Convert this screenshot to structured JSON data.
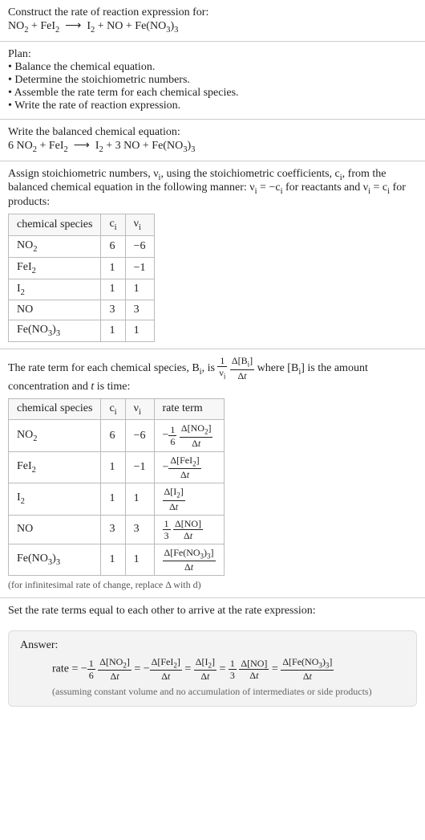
{
  "problem": {
    "prompt": "Construct the rate of reaction expression for:",
    "equation_html": "NO<sub>2</sub> + FeI<sub>2</sub> &nbsp;⟶&nbsp; I<sub>2</sub> + NO + Fe(NO<sub>3</sub>)<sub>3</sub>"
  },
  "plan": {
    "heading": "Plan:",
    "items": [
      "Balance the chemical equation.",
      "Determine the stoichiometric numbers.",
      "Assemble the rate term for each chemical species.",
      "Write the rate of reaction expression."
    ]
  },
  "balanced": {
    "heading": "Write the balanced chemical equation:",
    "equation_html": "6 NO<sub>2</sub> + FeI<sub>2</sub> &nbsp;⟶&nbsp; I<sub>2</sub> + 3 NO + Fe(NO<sub>3</sub>)<sub>3</sub>"
  },
  "stoich": {
    "intro_html": "Assign stoichiometric numbers, ν<sub>i</sub>, using the stoichiometric coefficients, c<sub>i</sub>, from the balanced chemical equation in the following manner: ν<sub>i</sub> = −c<sub>i</sub> for reactants and ν<sub>i</sub> = c<sub>i</sub> for products:",
    "headers": {
      "species": "chemical species",
      "c": "c<sub>i</sub>",
      "nu": "ν<sub>i</sub>"
    },
    "rows": [
      {
        "species_html": "NO<sub>2</sub>",
        "c": "6",
        "nu": "−6"
      },
      {
        "species_html": "FeI<sub>2</sub>",
        "c": "1",
        "nu": "−1"
      },
      {
        "species_html": "I<sub>2</sub>",
        "c": "1",
        "nu": "1"
      },
      {
        "species_html": "NO",
        "c": "3",
        "nu": "3"
      },
      {
        "species_html": "Fe(NO<sub>3</sub>)<sub>3</sub>",
        "c": "1",
        "nu": "1"
      }
    ]
  },
  "rate_terms": {
    "intro_pre": "The rate term for each chemical species, B<sub>i</sub>, is ",
    "intro_post": " where [B<sub>i</sub>] is the amount concentration and <i>t</i> is time:",
    "headers": {
      "species": "chemical species",
      "c": "c<sub>i</sub>",
      "nu": "ν<sub>i</sub>",
      "rate": "rate term"
    },
    "rows": [
      {
        "species_html": "NO<sub>2</sub>",
        "c": "6",
        "nu": "−6",
        "rate_html": "−<span class='frac'><span class='num'>1</span><span class='den'>6</span></span> <span class='frac'><span class='num'>Δ[NO<sub>2</sub>]</span><span class='den'>Δ<i>t</i></span></span>"
      },
      {
        "species_html": "FeI<sub>2</sub>",
        "c": "1",
        "nu": "−1",
        "rate_html": "−<span class='frac'><span class='num'>Δ[FeI<sub>2</sub>]</span><span class='den'>Δ<i>t</i></span></span>"
      },
      {
        "species_html": "I<sub>2</sub>",
        "c": "1",
        "nu": "1",
        "rate_html": "<span class='frac'><span class='num'>Δ[I<sub>2</sub>]</span><span class='den'>Δ<i>t</i></span></span>"
      },
      {
        "species_html": "NO",
        "c": "3",
        "nu": "3",
        "rate_html": "<span class='frac'><span class='num'>1</span><span class='den'>3</span></span> <span class='frac'><span class='num'>Δ[NO]</span><span class='den'>Δ<i>t</i></span></span>"
      },
      {
        "species_html": "Fe(NO<sub>3</sub>)<sub>3</sub>",
        "c": "1",
        "nu": "1",
        "rate_html": "<span class='frac'><span class='num'>Δ[Fe(NO<sub>3</sub>)<sub>3</sub>]</span><span class='den'>Δ<i>t</i></span></span>"
      }
    ],
    "note": "(for infinitesimal rate of change, replace Δ with d)"
  },
  "final": {
    "heading": "Set the rate terms equal to each other to arrive at the rate expression:",
    "answer_label": "Answer:",
    "rate_expr_html": "rate = −<span class='frac'><span class='num'>1</span><span class='den'>6</span></span> <span class='frac'><span class='num'>Δ[NO<sub>2</sub>]</span><span class='den'>Δ<i>t</i></span></span> = −<span class='frac'><span class='num'>Δ[FeI<sub>2</sub>]</span><span class='den'>Δ<i>t</i></span></span> = <span class='frac'><span class='num'>Δ[I<sub>2</sub>]</span><span class='den'>Δ<i>t</i></span></span> = <span class='frac'><span class='num'>1</span><span class='den'>3</span></span> <span class='frac'><span class='num'>Δ[NO]</span><span class='den'>Δ<i>t</i></span></span> = <span class='frac'><span class='num'>Δ[Fe(NO<sub>3</sub>)<sub>3</sub>]</span><span class='den'>Δ<i>t</i></span></span>",
    "assumption": "(assuming constant volume and no accumulation of intermediates or side products)"
  },
  "generic_rate_frac_html": "<span class='frac'><span class='num'>1</span><span class='den'>ν<sub>i</sub></span></span> <span class='frac'><span class='num'>Δ[B<sub>i</sub>]</span><span class='den'>Δ<i>t</i></span></span>"
}
